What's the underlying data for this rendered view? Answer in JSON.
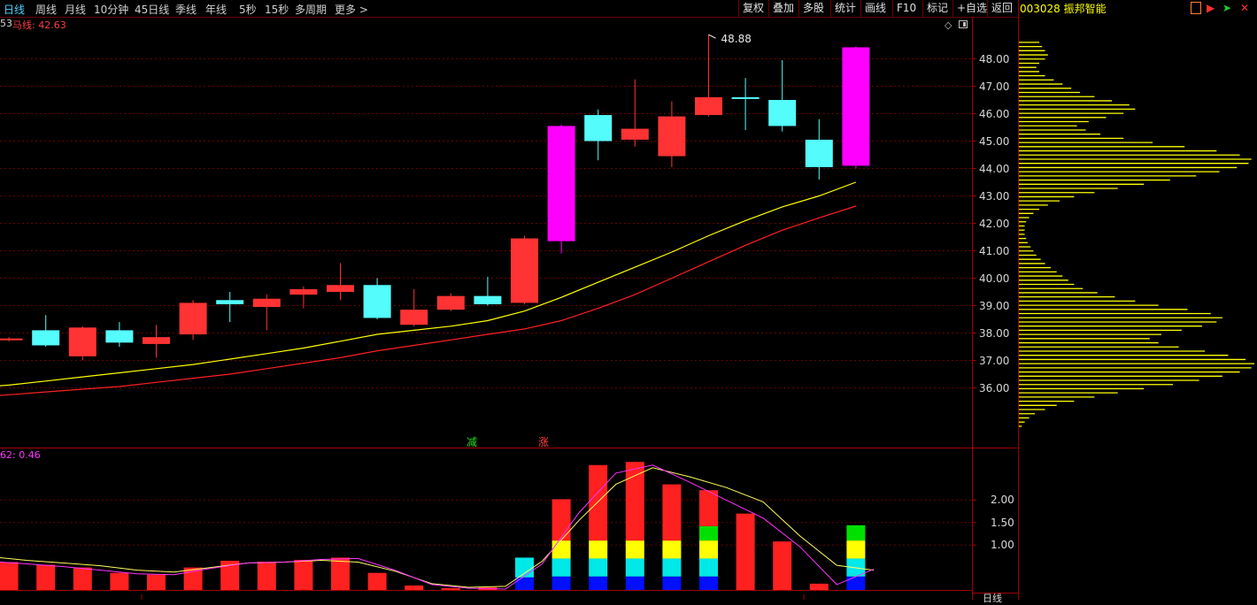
{
  "toolbar": {
    "tabs": [
      "日线",
      "周线",
      "月线",
      "10分钟",
      "45日线",
      "季线",
      "年线",
      "5秒",
      "15秒",
      "多周期",
      "更多 >"
    ],
    "active_tab": "日线",
    "right_buttons": [
      "复权",
      "叠加",
      "多股",
      "统计",
      "画线",
      "F10",
      "标记",
      "+自选",
      "返回"
    ]
  },
  "stock": {
    "code_name": "003028 振邦智能"
  },
  "main_panel": {
    "ma_legend_prefix": "53",
    "ma_legend": "马线: 42.63",
    "high_marker": "48.88",
    "signal_down": "减",
    "signal_up": "涨"
  },
  "sub_panel": {
    "legend": "62: 0.46",
    "period_label": "日线"
  },
  "colors": {
    "up": "#ff3333",
    "down": "#54fcfc",
    "limit_up": "#ff00ff",
    "ma_short": "#ffff00",
    "ma_long": "#ff2020",
    "grid": "#6a0000",
    "axis_text": "#d8d8d8"
  },
  "chart_data": [
    {
      "type": "candlestick",
      "title": "",
      "price_axis_ticks": [
        36.0,
        37.0,
        38.0,
        39.0,
        40.0,
        41.0,
        42.0,
        43.0,
        44.0,
        45.0,
        46.0,
        47.0,
        48.0
      ],
      "ylim": [
        34.6,
        49.5
      ],
      "candles": [
        {
          "o": 37.8,
          "c": 37.8,
          "h": 37.85,
          "l": 37.7
        },
        {
          "o": 38.1,
          "c": 37.55,
          "h": 38.65,
          "l": 37.5
        },
        {
          "o": 37.15,
          "c": 38.2,
          "h": 38.25,
          "l": 37.0
        },
        {
          "o": 38.1,
          "c": 37.65,
          "h": 38.4,
          "l": 37.5
        },
        {
          "o": 37.6,
          "c": 37.85,
          "h": 38.3,
          "l": 37.1
        },
        {
          "o": 37.95,
          "c": 39.1,
          "h": 39.2,
          "l": 37.75
        },
        {
          "o": 39.2,
          "c": 39.05,
          "h": 39.5,
          "l": 38.4
        },
        {
          "o": 38.95,
          "c": 39.25,
          "h": 39.4,
          "l": 38.1
        },
        {
          "o": 39.4,
          "c": 39.6,
          "h": 39.7,
          "l": 38.9
        },
        {
          "o": 39.5,
          "c": 39.75,
          "h": 40.55,
          "l": 39.2
        },
        {
          "o": 39.75,
          "c": 38.55,
          "h": 40.0,
          "l": 38.5
        },
        {
          "o": 38.3,
          "c": 38.85,
          "h": 39.6,
          "l": 38.25
        },
        {
          "o": 38.85,
          "c": 39.35,
          "h": 39.45,
          "l": 38.8
        },
        {
          "o": 39.35,
          "c": 39.05,
          "h": 40.05,
          "l": 39.0
        },
        {
          "o": 39.1,
          "c": 41.45,
          "h": 41.55,
          "l": 39.05
        },
        {
          "o": 41.35,
          "c": 45.55,
          "h": 45.6,
          "l": 40.9
        },
        {
          "o": 45.95,
          "c": 45.0,
          "h": 46.15,
          "l": 44.3
        },
        {
          "o": 45.05,
          "c": 45.45,
          "h": 47.25,
          "l": 44.8
        },
        {
          "o": 44.45,
          "c": 45.9,
          "h": 46.45,
          "l": 44.05
        },
        {
          "o": 45.95,
          "c": 46.6,
          "h": 48.88,
          "l": 45.9
        },
        {
          "o": 46.6,
          "c": 46.55,
          "h": 47.3,
          "l": 45.4
        },
        {
          "o": 46.5,
          "c": 45.55,
          "h": 47.95,
          "l": 45.35
        },
        {
          "o": 45.05,
          "c": 44.05,
          "h": 45.8,
          "l": 43.6
        },
        {
          "o": 44.1,
          "c": 48.42,
          "h": 48.45,
          "l": 44.0
        }
      ],
      "ma_short": [
        36.0,
        36.1,
        36.25,
        36.4,
        36.55,
        36.7,
        36.85,
        37.05,
        37.25,
        37.45,
        37.7,
        37.95,
        38.1,
        38.25,
        38.45,
        38.8,
        39.3,
        39.85,
        40.4,
        40.95,
        41.55,
        42.1,
        42.6,
        43.0,
        43.5
      ],
      "ma_long": [
        35.65,
        35.75,
        35.85,
        35.95,
        36.05,
        36.2,
        36.35,
        36.5,
        36.7,
        36.9,
        37.1,
        37.35,
        37.55,
        37.75,
        37.95,
        38.15,
        38.45,
        38.9,
        39.4,
        40.0,
        40.6,
        41.2,
        41.75,
        42.2,
        42.63
      ]
    },
    {
      "type": "bar",
      "title": "",
      "xlabel": "",
      "ylabel": "",
      "yticks": [
        1.0,
        1.5,
        2.0
      ],
      "ylim": [
        0,
        2.8
      ],
      "values": [
        0.62,
        0.56,
        0.5,
        0.38,
        0.34,
        0.5,
        0.65,
        0.63,
        0.67,
        0.72,
        0.38,
        0.1,
        0.04,
        0.06,
        0.72,
        2.02,
        2.78,
        2.85,
        2.35,
        2.22,
        1.7,
        1.08,
        0.14,
        1.44
      ],
      "segments": [
        {
          "index": 14,
          "stack": [
            {
              "c": "blue",
              "v": 0.28
            },
            {
              "c": "cyan",
              "v": 0.44
            }
          ]
        },
        {
          "index": 15,
          "stack": [
            {
              "c": "blue",
              "v": 0.3
            },
            {
              "c": "cyan",
              "v": 0.4
            },
            {
              "c": "yellow",
              "v": 0.4
            },
            {
              "c": "red",
              "v": 0.92
            }
          ]
        },
        {
          "index": 16,
          "stack": [
            {
              "c": "blue",
              "v": 0.3
            },
            {
              "c": "cyan",
              "v": 0.4
            },
            {
              "c": "yellow",
              "v": 0.4
            },
            {
              "c": "red",
              "v": 1.68
            }
          ]
        },
        {
          "index": 17,
          "stack": [
            {
              "c": "blue",
              "v": 0.3
            },
            {
              "c": "cyan",
              "v": 0.4
            },
            {
              "c": "yellow",
              "v": 0.4
            },
            {
              "c": "red",
              "v": 1.75
            }
          ]
        },
        {
          "index": 18,
          "stack": [
            {
              "c": "blue",
              "v": 0.3
            },
            {
              "c": "cyan",
              "v": 0.4
            },
            {
              "c": "yellow",
              "v": 0.4
            },
            {
              "c": "red",
              "v": 1.25
            }
          ]
        },
        {
          "index": 19,
          "stack": [
            {
              "c": "blue",
              "v": 0.3
            },
            {
              "c": "cyan",
              "v": 0.4
            },
            {
              "c": "yellow",
              "v": 0.4
            },
            {
              "c": "green",
              "v": 0.32
            },
            {
              "c": "red",
              "v": 0.8
            }
          ]
        },
        {
          "index": 23,
          "stack": [
            {
              "c": "blue",
              "v": 0.3
            },
            {
              "c": "cyan",
              "v": 0.4
            },
            {
              "c": "yellow",
              "v": 0.4
            },
            {
              "c": "green",
              "v": 0.34
            }
          ]
        }
      ],
      "line_yellow": [
        0.74,
        0.66,
        0.6,
        0.54,
        0.44,
        0.4,
        0.5,
        0.6,
        0.62,
        0.66,
        0.62,
        0.42,
        0.14,
        0.06,
        0.08,
        0.64,
        1.55,
        2.35,
        2.72,
        2.52,
        2.28,
        1.96,
        1.2,
        0.55,
        0.44
      ],
      "line_magenta": [
        0.64,
        0.58,
        0.52,
        0.44,
        0.36,
        0.34,
        0.48,
        0.6,
        0.62,
        0.68,
        0.7,
        0.44,
        0.12,
        0.04,
        0.02,
        0.58,
        1.72,
        2.6,
        2.78,
        2.4,
        2.0,
        1.6,
        0.96,
        0.12,
        0.46
      ]
    }
  ],
  "volume_profile": {
    "price_range": [
      34.6,
      48.6
    ],
    "profile": [
      0.1,
      0.2,
      0.35,
      0.55,
      0.9,
      1.3,
      1.9,
      2.6,
      3.4,
      4.3,
      5.3,
      6.2,
      7.0,
      7.6,
      8.0,
      8.1,
      7.8,
      7.2,
      6.4,
      5.5,
      4.8,
      4.5,
      4.9,
      5.6,
      6.3,
      6.8,
      7.0,
      6.6,
      5.8,
      4.8,
      4.0,
      3.3,
      2.7,
      2.2,
      1.9,
      1.7,
      1.5,
      1.3,
      1.1,
      0.9,
      0.75,
      0.6,
      0.5,
      0.4,
      0.3,
      0.25,
      0.2,
      0.2,
      0.2,
      0.25,
      0.35,
      0.5,
      0.7,
      1.0,
      1.4,
      1.9,
      2.6,
      3.4,
      4.3,
      5.2,
      6.1,
      6.9,
      7.5,
      7.9,
      8.0,
      7.6,
      6.8,
      5.7,
      4.6,
      3.6,
      2.8,
      2.3,
      2.0,
      2.4,
      3.0,
      3.6,
      4.0,
      3.8,
      3.2,
      2.6,
      2.1,
      1.8,
      1.5,
      1.2,
      0.9,
      0.7,
      0.6,
      0.7,
      0.9,
      1.0,
      0.9,
      0.8,
      0.7
    ]
  }
}
